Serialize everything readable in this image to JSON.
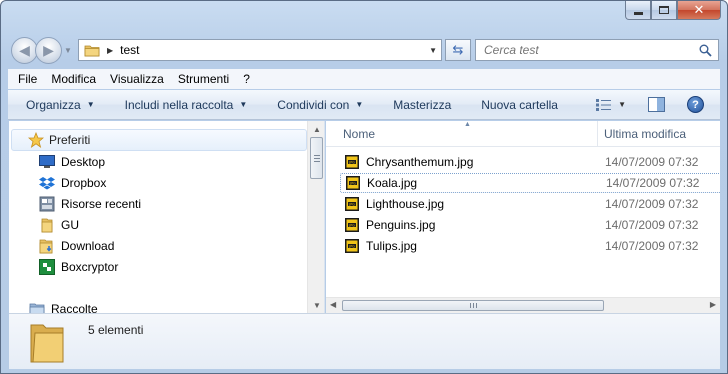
{
  "window": {
    "colors": {
      "frame": "#b9cfe9",
      "close_button": "#c3462c",
      "accent_text": "#1e395b"
    }
  },
  "address_bar": {
    "back_icon": "back-arrow-icon",
    "forward_icon": "forward-arrow-icon",
    "path": "test",
    "refresh_icon": "refresh-icon"
  },
  "search": {
    "placeholder": "Cerca test"
  },
  "menu": {
    "items": [
      "File",
      "Modifica",
      "Visualizza",
      "Strumenti",
      "?"
    ]
  },
  "toolbar": {
    "organize": "Organizza",
    "include_library": "Includi nella raccolta",
    "share_with": "Condividi con",
    "burn": "Masterizza",
    "new_folder": "Nuova cartella"
  },
  "navigation": {
    "favorites": "Preferiti",
    "items": [
      {
        "label": "Desktop",
        "icon": "desktop-icon"
      },
      {
        "label": "Dropbox",
        "icon": "dropbox-icon"
      },
      {
        "label": "Risorse recenti",
        "icon": "recent-places-icon"
      },
      {
        "label": "GU",
        "icon": "folder-icon"
      },
      {
        "label": "Download",
        "icon": "download-folder-icon"
      },
      {
        "label": "Boxcryptor",
        "icon": "boxcryptor-icon"
      }
    ],
    "libraries": "Raccolte"
  },
  "file_list": {
    "columns": {
      "name": "Nome",
      "modified": "Ultima modifica"
    },
    "files": [
      {
        "name": "Chrysanthemum.jpg",
        "modified": "14/07/2009 07:32"
      },
      {
        "name": "Koala.jpg",
        "modified": "14/07/2009 07:32",
        "focused": true
      },
      {
        "name": "Lighthouse.jpg",
        "modified": "14/07/2009 07:32"
      },
      {
        "name": "Penguins.jpg",
        "modified": "14/07/2009 07:32"
      },
      {
        "name": "Tulips.jpg",
        "modified": "14/07/2009 07:32"
      }
    ]
  },
  "details_pane": {
    "count": "5 elementi"
  }
}
